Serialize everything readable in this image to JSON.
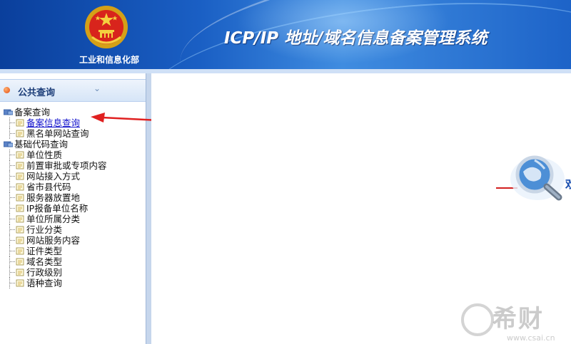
{
  "header": {
    "ministry": "工业和信息化部",
    "system_title": "ICP/IP 地址/域名信息备案管理系统"
  },
  "sidebar": {
    "section_title": "公共查询",
    "collapse_icon": "double-chevron-down-icon",
    "tree": [
      {
        "label": "备案查询",
        "children": [
          {
            "label": "备案信息查询",
            "link": true
          },
          {
            "label": "黑名单网站查询",
            "link": false
          }
        ]
      },
      {
        "label": "基础代码查询",
        "children": [
          {
            "label": "单位性质"
          },
          {
            "label": "前置审批或专项内容"
          },
          {
            "label": "网站接入方式"
          },
          {
            "label": "省市县代码"
          },
          {
            "label": "服务器放置地"
          },
          {
            "label": "IP报备单位名称"
          },
          {
            "label": "单位所属分类"
          },
          {
            "label": "行业分类"
          },
          {
            "label": "网站服务内容"
          },
          {
            "label": "证件类型"
          },
          {
            "label": "域名类型"
          },
          {
            "label": "行政级别"
          },
          {
            "label": "语种查询"
          }
        ]
      }
    ]
  },
  "main": {
    "partial_text": "欢"
  },
  "watermark": {
    "big": "希财",
    "small": "www.csai.cn"
  },
  "colors": {
    "header_blue": "#1a5fc4",
    "link_blue": "#1010cc",
    "arrow_red": "#e02020"
  }
}
